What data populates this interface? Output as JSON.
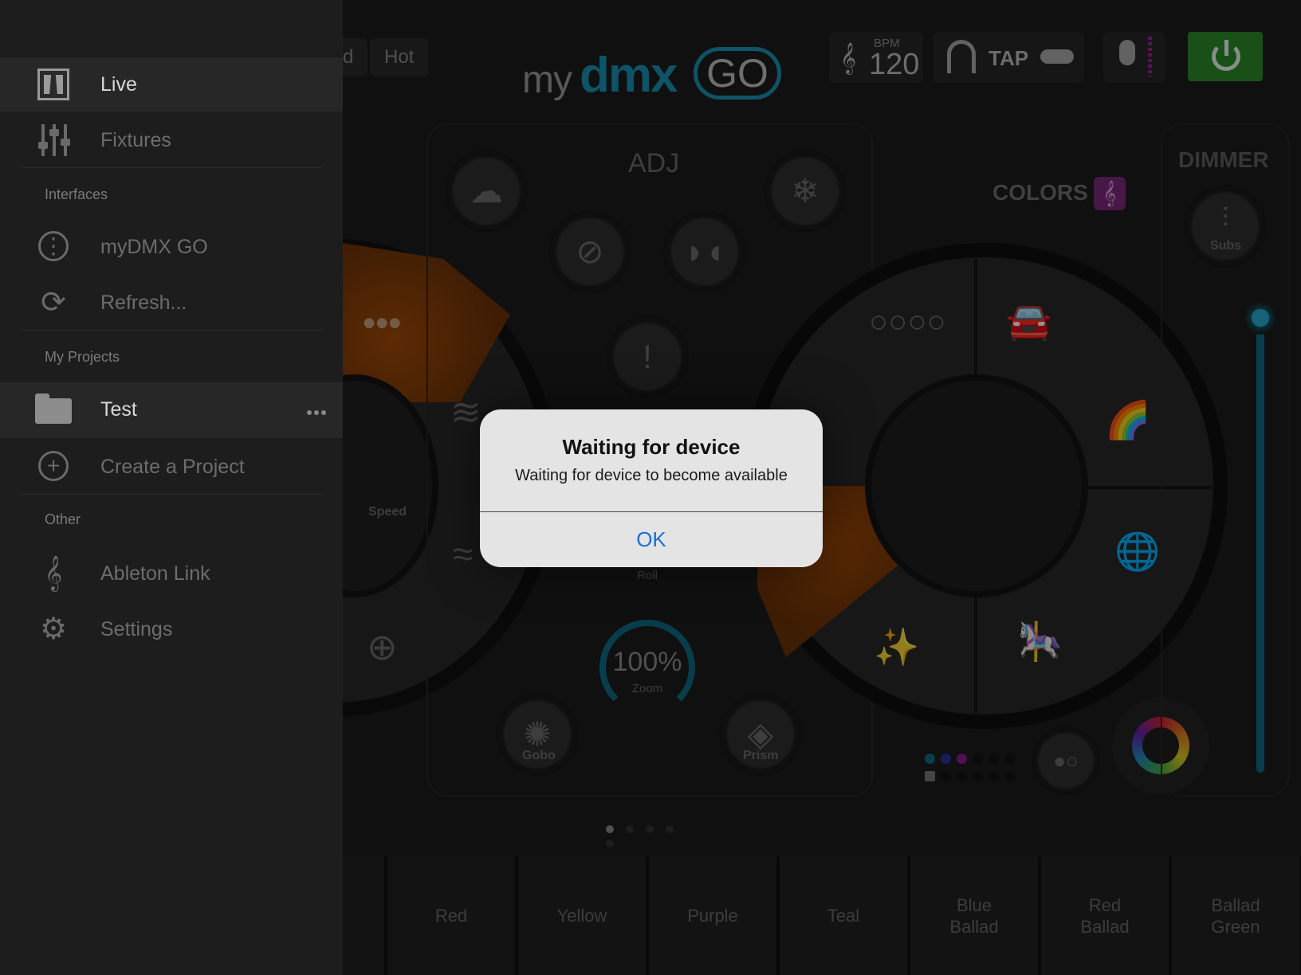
{
  "sidebar": {
    "items_top": [
      {
        "label": "Live",
        "icon": "live-icon",
        "selected": true
      },
      {
        "label": "Fixtures",
        "icon": "faders-icon"
      }
    ],
    "interfaces_header": "Interfaces",
    "interfaces": [
      {
        "label": "myDMX GO",
        "icon": "mydmx-go-device-icon"
      },
      {
        "label": "Refresh...",
        "icon": "refresh-icon"
      }
    ],
    "projects_header": "My Projects",
    "projects": [
      {
        "label": "Test",
        "icon": "folder-icon",
        "selected": true
      },
      {
        "label": "Create a Project",
        "icon": "plus-circle-icon"
      }
    ],
    "other_header": "Other",
    "other": [
      {
        "label": "Ableton Link",
        "icon": "ableton-link-icon"
      },
      {
        "label": "Settings",
        "icon": "gear-icon"
      }
    ]
  },
  "topbar": {
    "tab_partial": "d",
    "tab_hot": "Hot",
    "logo": {
      "my": "my",
      "dmx": "dmx",
      "go": "GO"
    },
    "bpm_label": "BPM",
    "bpm_value": "120",
    "tap_label": "TAP"
  },
  "controls": {
    "colors_label": "COLORS",
    "dimmer_label": "DIMMER",
    "subs_label": "Subs",
    "speed_label": "Speed",
    "roll_label": "Roll",
    "zoom_value": "100%",
    "zoom_label": "Zoom",
    "gobo_label": "Gobo",
    "prism_label": "Prism",
    "page_count": 5,
    "active_page": 1
  },
  "scenes": [
    "Red",
    "Yellow",
    "Purple",
    "Teal",
    "Blue\nBallad",
    "Red\nBallad",
    "Ballad\nGreen"
  ],
  "alert": {
    "title": "Waiting for device",
    "message": "Waiting for device to become available",
    "ok_label": "OK"
  },
  "colors": {
    "accent_blue": "#1b8fb0",
    "power_green": "#2a8a2a",
    "wedge_orange": "#a14a07",
    "alert_button": "#1a70d8"
  }
}
